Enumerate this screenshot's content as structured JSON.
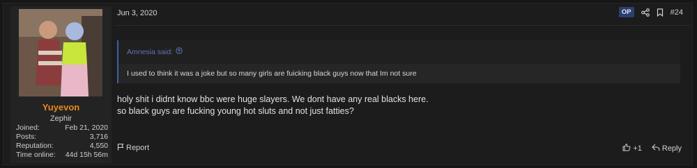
{
  "user": {
    "name": "Yuyevon",
    "title": "Zephir",
    "stats": [
      {
        "label": "Joined:",
        "value": "Feb 21, 2020"
      },
      {
        "label": "Posts:",
        "value": "3,716"
      },
      {
        "label": "Reputation:",
        "value": "4,550"
      },
      {
        "label": "Time online:",
        "value": "44d 15h 56m"
      }
    ]
  },
  "post": {
    "date": "Jun 3, 2020",
    "op_badge": "OP",
    "number": "#24",
    "quote": {
      "author": "Amnesia said:",
      "text": "I used to think it was a joke but so many girls are fuicking black guys now that Im not sure"
    },
    "message": [
      "holy shit i didnt know bbc were huge slayers. We dont have any real blacks here.",
      "so black guys are fucking young hot sluts and not just fatties?"
    ],
    "report_label": "Report",
    "reaction_count": "+1",
    "reply_label": "Reply"
  },
  "colors": {
    "accent": "#e8891e",
    "quote_border": "#3f5fa8",
    "op_badge": "#2a3f6c"
  }
}
